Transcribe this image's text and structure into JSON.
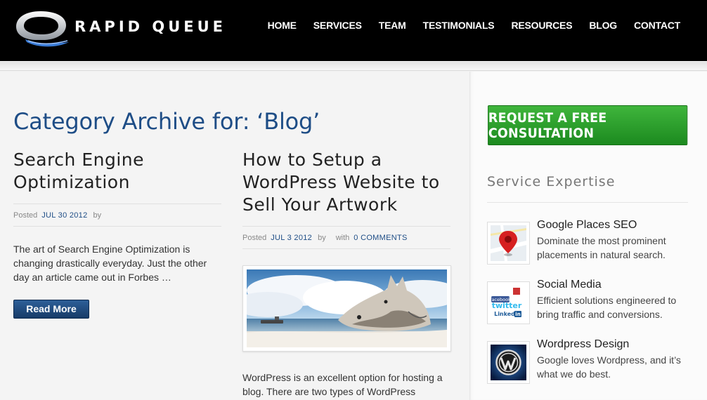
{
  "brand": {
    "name": "RAPID QUEUE"
  },
  "nav": [
    {
      "label": "HOME"
    },
    {
      "label": "SERVICES"
    },
    {
      "label": "TEAM"
    },
    {
      "label": "TESTIMONIALS"
    },
    {
      "label": "RESOURCES"
    },
    {
      "label": "BLOG"
    },
    {
      "label": "CONTACT"
    }
  ],
  "archive": {
    "title": "Category Archive for: ‘Blog’"
  },
  "posts": [
    {
      "title_lines": [
        "Search Engine",
        "Optimization"
      ],
      "posted_label": "Posted",
      "date": "JUL 30 2012",
      "by_label": "by",
      "excerpt": "The art of Search Engine Optimization is changing drastically everyday. Just the other day an article came out in Forbes …",
      "button_label": "Read More"
    },
    {
      "title_lines": [
        "How to Setup a",
        "WordPress Website to",
        "Sell Your Artwork"
      ],
      "posted_label": "Posted",
      "date": "JUL 3 2012",
      "by_label": "by",
      "with_label": "with",
      "comments": "0 COMMENTS",
      "excerpt": "WordPress is an excellent option for hosting a blog. There are two types of WordPress"
    }
  ],
  "sidebar": {
    "cta_label": "REQUEST A FREE CONSULTATION",
    "heading": "Service Expertise",
    "services": [
      {
        "title": "Google Places SEO",
        "desc": "Dominate the most prominent placements in natural search.",
        "icon": "map-pin-icon"
      },
      {
        "title": "Social Media",
        "desc": "Efficient solutions engineered to bring traffic and conversions.",
        "icon": "social-media-icon",
        "icon_labels": [
          "facebook",
          "twitter",
          "Linked",
          "in"
        ]
      },
      {
        "title": "Wordpress Design",
        "desc": "Google loves Wordpress, and it’s what we do best.",
        "icon": "wordpress-icon"
      }
    ]
  },
  "colors": {
    "accent": "#1e4d86",
    "cta": "#2aa12a",
    "header": "#000000"
  }
}
